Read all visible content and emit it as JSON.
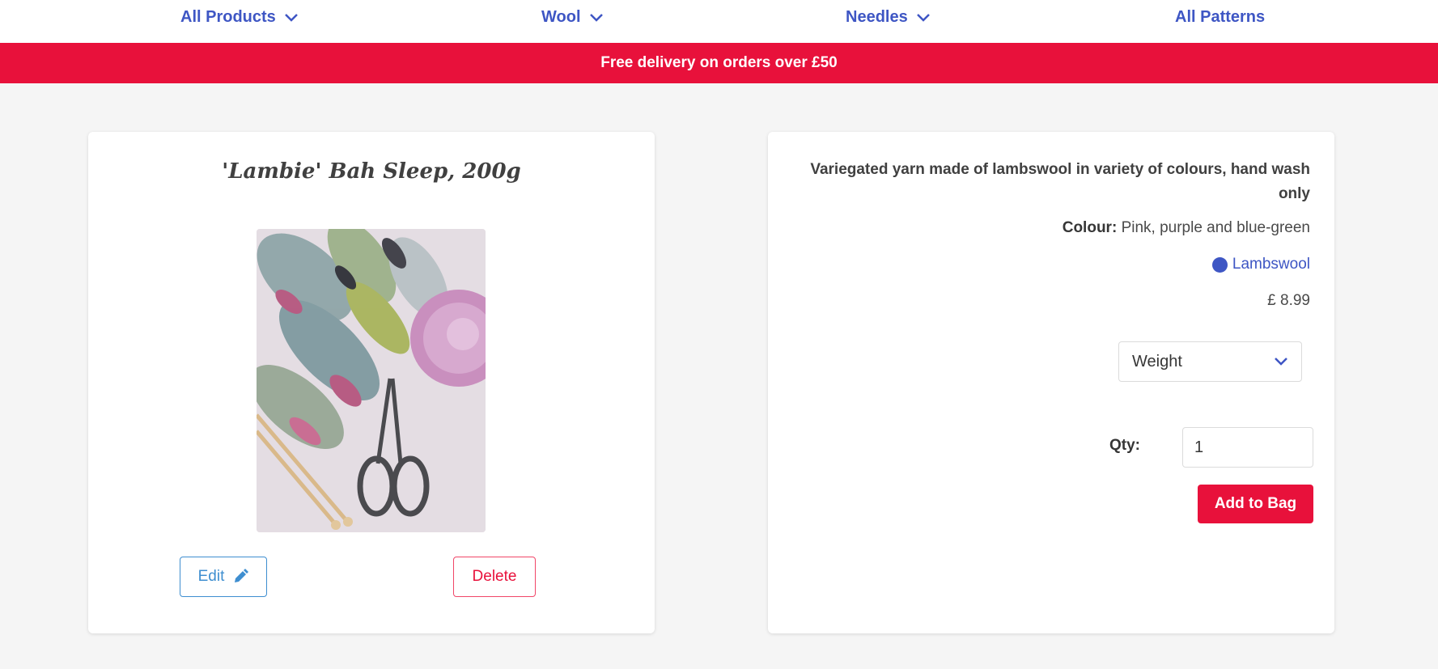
{
  "nav": {
    "items": [
      {
        "label": "All Products",
        "has_dropdown": true
      },
      {
        "label": "Wool",
        "has_dropdown": true
      },
      {
        "label": "Needles",
        "has_dropdown": true
      },
      {
        "label": "All Patterns",
        "has_dropdown": false
      }
    ]
  },
  "banner": {
    "text": "Free delivery on orders over £50"
  },
  "product": {
    "title": "'Lambie' Bah Sleep, 200g",
    "image_icon": "yarn-photo",
    "edit_label": "Edit",
    "delete_label": "Delete",
    "description": "Variegated yarn made of lambswool in variety of colours, hand wash only",
    "colour_label": "Colour:",
    "colour_value": "Pink, purple and blue-green",
    "material": "Lambswool",
    "price": "£ 8.99",
    "weight_select": "Weight",
    "qty_label": "Qty:",
    "qty_value": "1",
    "add_label": "Add to Bag"
  },
  "colors": {
    "accent": "#3e56c4",
    "brand_red": "#e8113b",
    "edit_blue": "#3e8ed0",
    "background": "#f5f5f5"
  }
}
